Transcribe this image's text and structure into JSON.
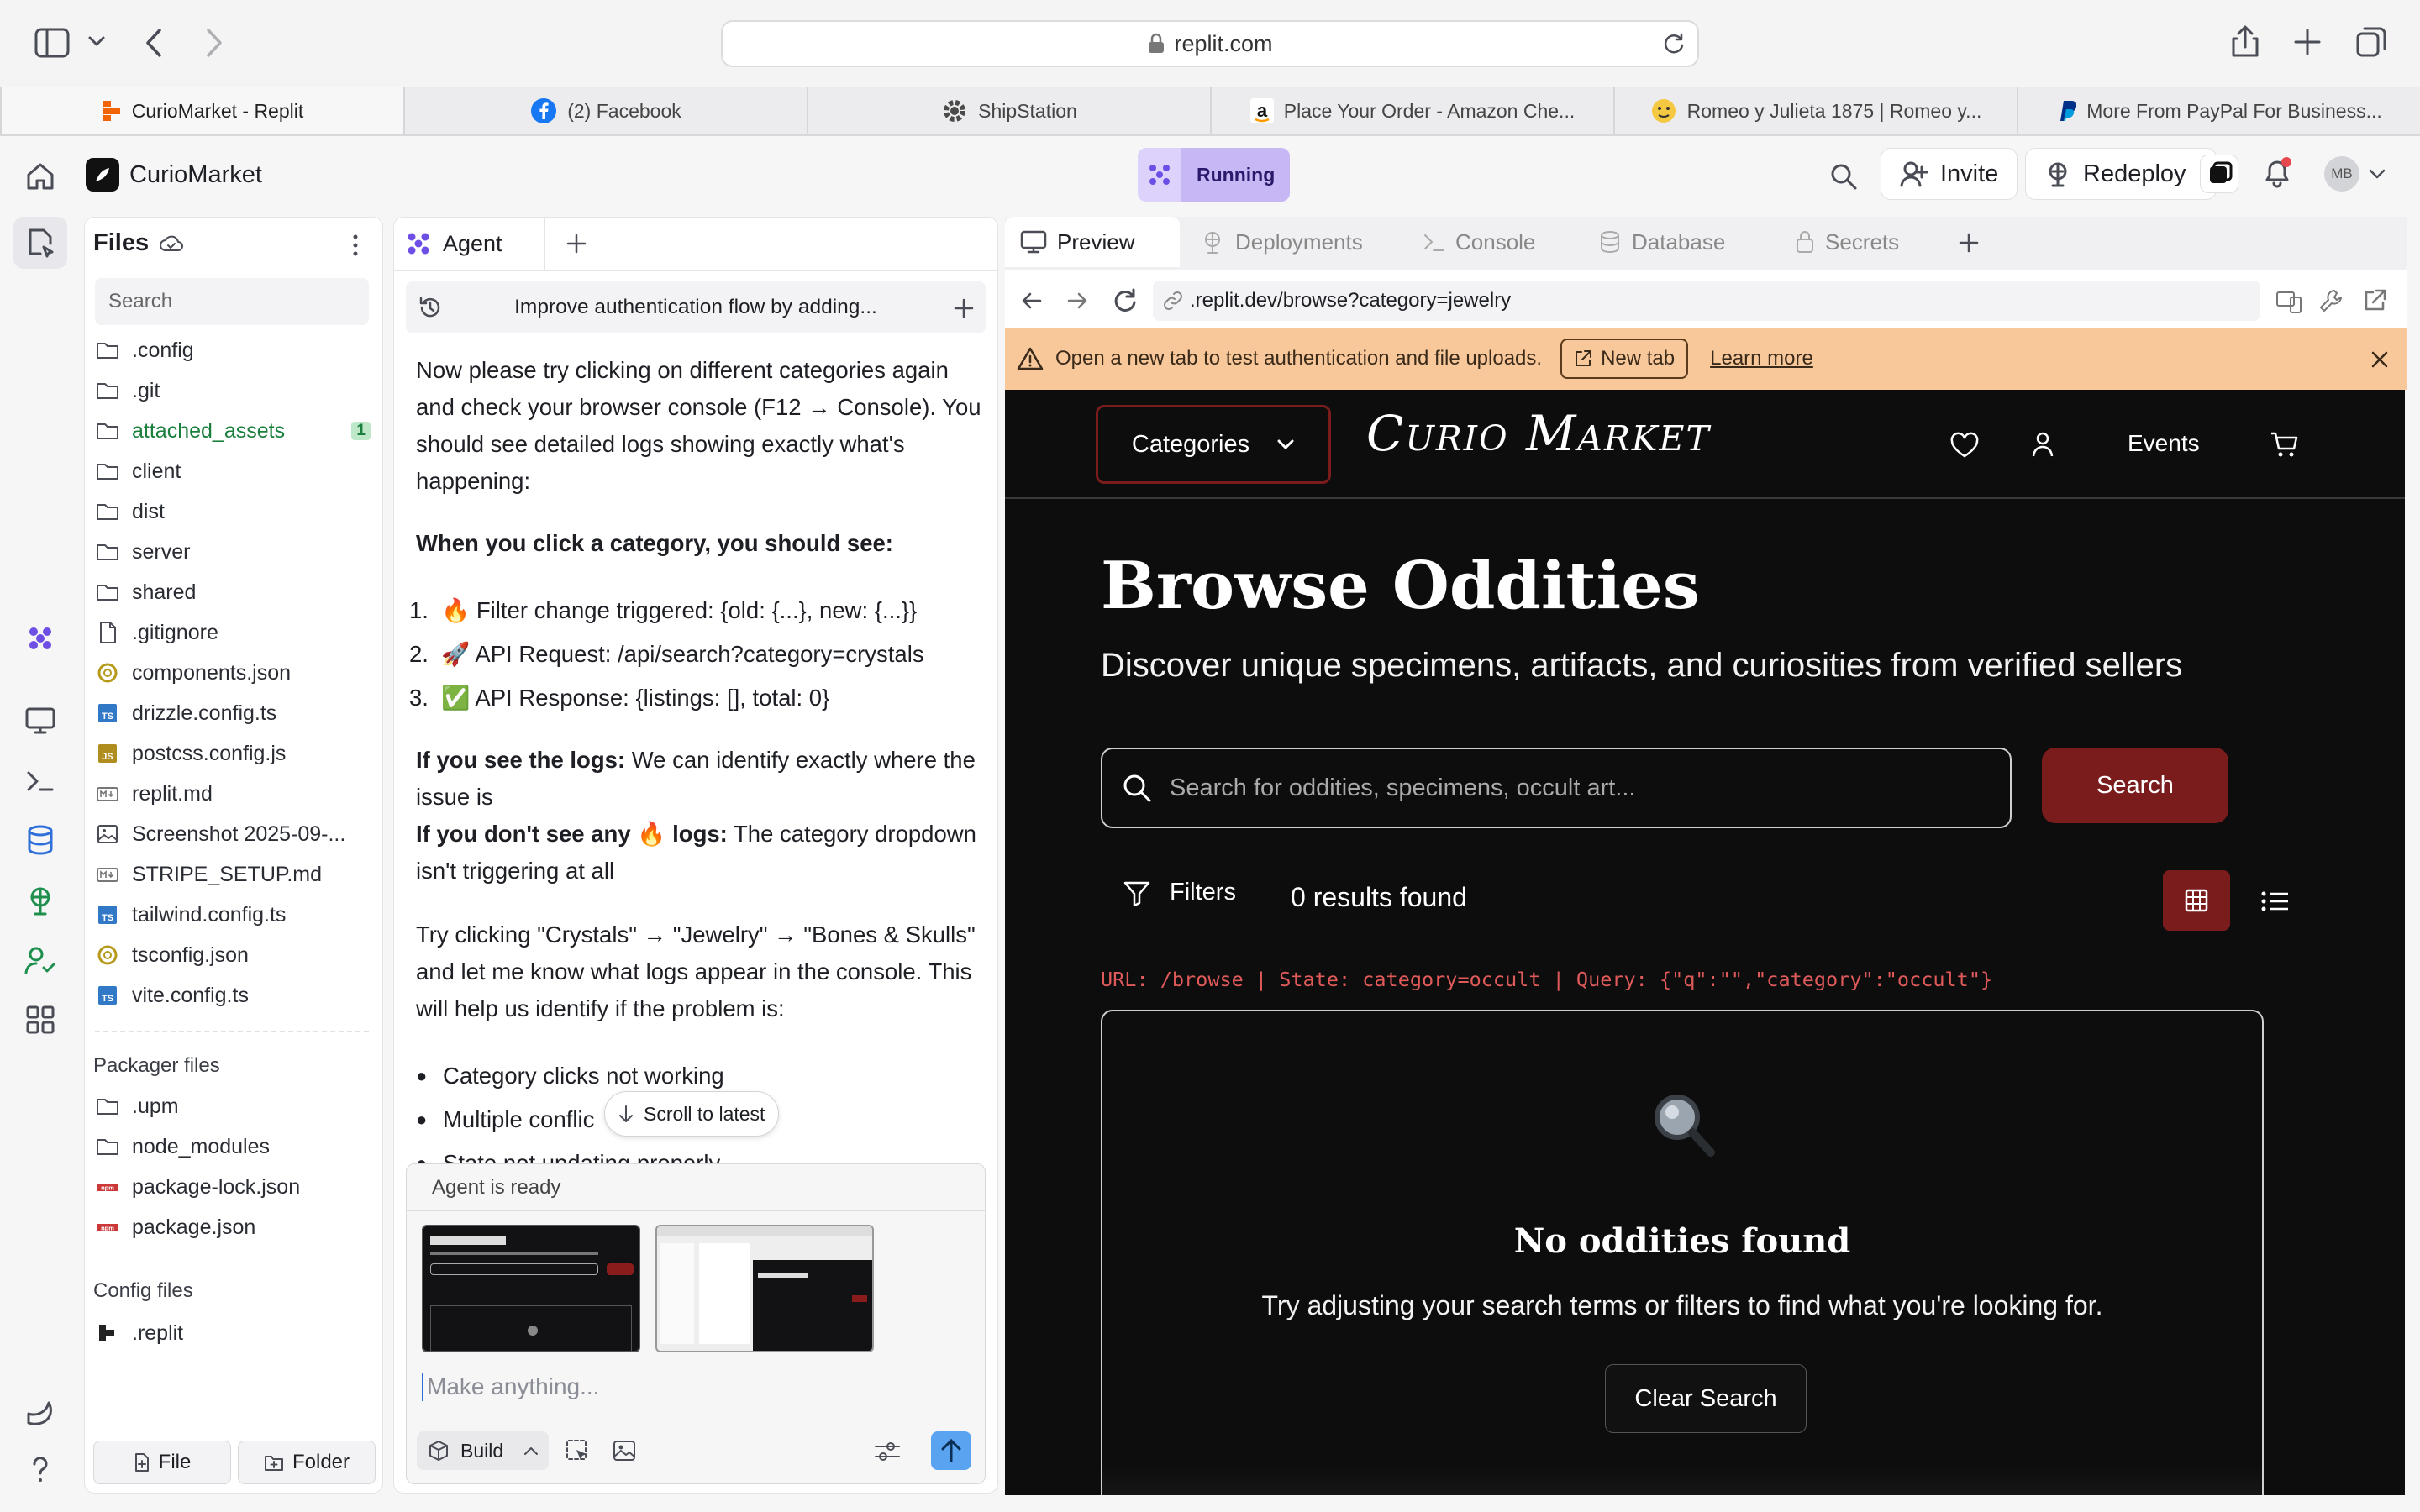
{
  "browser": {
    "url": "replit.com",
    "tabs": [
      {
        "title": "CurioMarket - Replit",
        "icon": "replit-icon"
      },
      {
        "title": "(2) Facebook",
        "icon": "facebook-icon"
      },
      {
        "title": "ShipStation",
        "icon": "gear-icon"
      },
      {
        "title": "Place Your Order - Amazon Che...",
        "icon": "amazon-icon"
      },
      {
        "title": "Romeo y Julieta 1875 | Romeo y...",
        "icon": "emoji-icon"
      },
      {
        "title": "More From PayPal For Business...",
        "icon": "paypal-icon"
      }
    ]
  },
  "header": {
    "project": "CurioMarket",
    "run_status": "Running",
    "invite": "Invite",
    "redeploy": "Redeploy",
    "avatar": "MB"
  },
  "files": {
    "title": "Files",
    "search_placeholder": "Search",
    "items": [
      {
        "name": ".config",
        "type": "folder"
      },
      {
        "name": ".git",
        "type": "folder"
      },
      {
        "name": "attached_assets",
        "type": "folder",
        "badge": "1"
      },
      {
        "name": "client",
        "type": "folder"
      },
      {
        "name": "dist",
        "type": "folder"
      },
      {
        "name": "server",
        "type": "folder"
      },
      {
        "name": "shared",
        "type": "folder"
      },
      {
        "name": ".gitignore",
        "type": "file"
      },
      {
        "name": "components.json",
        "type": "json"
      },
      {
        "name": "drizzle.config.ts",
        "type": "ts"
      },
      {
        "name": "postcss.config.js",
        "type": "js"
      },
      {
        "name": "replit.md",
        "type": "md"
      },
      {
        "name": "Screenshot 2025-09-...",
        "type": "image"
      },
      {
        "name": "STRIPE_SETUP.md",
        "type": "md"
      },
      {
        "name": "tailwind.config.ts",
        "type": "ts"
      },
      {
        "name": "tsconfig.json",
        "type": "json"
      },
      {
        "name": "vite.config.ts",
        "type": "ts"
      }
    ],
    "packager_label": "Packager files",
    "packager_items": [
      {
        "name": ".upm",
        "type": "folder"
      },
      {
        "name": "node_modules",
        "type": "folder"
      },
      {
        "name": "package-lock.json",
        "type": "npm"
      },
      {
        "name": "package.json",
        "type": "npm"
      }
    ],
    "config_label": "Config files",
    "config_items": [
      {
        "name": ".replit",
        "type": "replit"
      }
    ],
    "new_file": "File",
    "new_folder": "Folder"
  },
  "agent": {
    "tab": "Agent",
    "thread_title": "Improve authentication flow by adding...",
    "p1": "Now please try clicking on different categories again and check your browser console (F12 → Console). You should see detailed logs showing exactly what's happening:",
    "h1": "When you click a category, you should see:",
    "steps": [
      "🔥 Filter change triggered: {old: {...}, new: {...}}",
      "🚀 API Request: /api/search?category=crystals",
      "✅ API Response: {listings: [], total: 0}"
    ],
    "if_see_bold": "If you see the logs:",
    "if_see_text": "We can identify exactly where the issue is",
    "if_not_bold": "If you don't see any 🔥 logs:",
    "if_not_text": "The category dropdown isn't triggering at all",
    "p2": "Try clicking \"Crystals\" → \"Jewelry\" → \"Bones & Skulls\" and let me know what logs appear in the console. This will help us identify if the problem is:",
    "bullets": [
      "Category clicks not working",
      "Multiple conflic",
      "State not updating properly"
    ],
    "scroll_latest": "Scroll to latest",
    "status": "Agent is ready",
    "input_placeholder": "Make anything...",
    "mode": "Build"
  },
  "preview": {
    "tabs": [
      "Preview",
      "Deployments",
      "Console",
      "Database",
      "Secrets"
    ],
    "address": ".replit.dev/browse?category=jewelry",
    "banner_text": "Open a new tab to test authentication and file uploads.",
    "banner_button": "New tab",
    "banner_link": "Learn more"
  },
  "site": {
    "categories": "Categories",
    "logo": "Curio Market",
    "events": "Events",
    "title": "Browse Oddities",
    "subtitle": "Discover unique specimens, artifacts, and curiosities from verified sellers",
    "search_placeholder": "Search for oddities, specimens, occult art...",
    "search_button": "Search",
    "filters": "Filters",
    "results": "0 results found",
    "debug": "URL: /browse | State: category=occult | Query: {\"q\":\"\",\"category\":\"occult\"}",
    "empty_title": "No oddities found",
    "empty_text": "Try adjusting your search terms or filters to find what you're looking for.",
    "clear": "Clear Search"
  },
  "colors": {
    "accent_red": "#7a1c1c",
    "banner": "#f8c89a",
    "running": "#c7b8f5",
    "replit_orange": "#f26207"
  }
}
